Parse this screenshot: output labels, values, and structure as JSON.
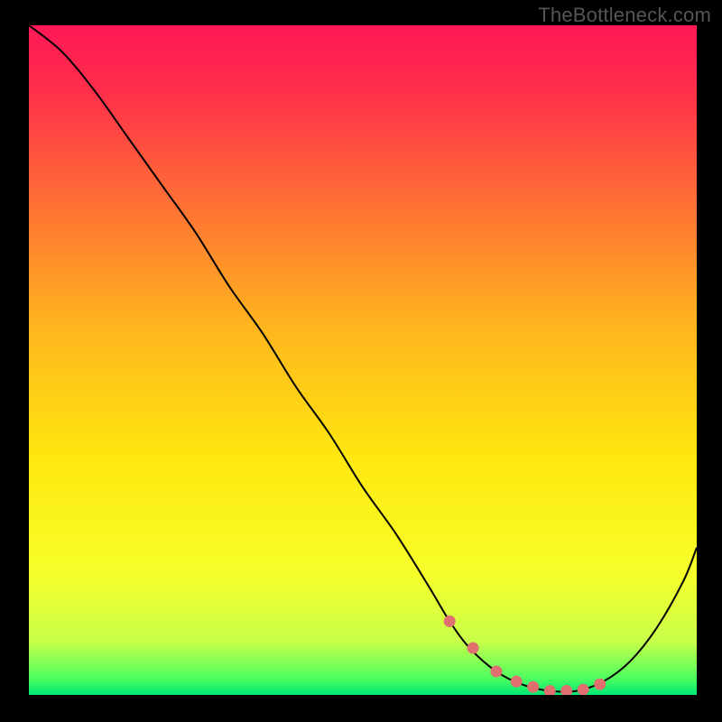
{
  "watermark": "TheBottleneck.com",
  "chart_data": {
    "type": "line",
    "title": "",
    "xlabel": "",
    "ylabel": "",
    "xlim": [
      0,
      100
    ],
    "ylim": [
      0,
      100
    ],
    "series": [
      {
        "name": "curve",
        "x": [
          0,
          5,
          10,
          15,
          20,
          25,
          30,
          35,
          40,
          45,
          50,
          55,
          60,
          63,
          66,
          70,
          74,
          78,
          82,
          86,
          90,
          94,
          98,
          100
        ],
        "y": [
          100,
          96,
          90,
          83,
          76,
          69,
          61,
          54,
          46,
          39,
          31,
          24,
          16,
          11,
          7,
          3.5,
          1.5,
          0.6,
          0.6,
          2,
          5,
          10,
          17,
          22
        ]
      }
    ],
    "markers": {
      "name": "dots",
      "x": [
        63,
        66.5,
        70,
        73,
        75.5,
        78,
        80.5,
        83,
        85.5
      ],
      "y": [
        11,
        7,
        3.5,
        2,
        1.2,
        0.6,
        0.6,
        0.8,
        1.6
      ]
    },
    "gradient_stops": [
      {
        "offset": 0.0,
        "color": "#ff1857"
      },
      {
        "offset": 0.1,
        "color": "#ff2f4a"
      },
      {
        "offset": 0.25,
        "color": "#ff6a37"
      },
      {
        "offset": 0.45,
        "color": "#ffb51e"
      },
      {
        "offset": 0.65,
        "color": "#ffe80f"
      },
      {
        "offset": 0.82,
        "color": "#f6ff2a"
      },
      {
        "offset": 0.92,
        "color": "#c8ff4a"
      },
      {
        "offset": 0.975,
        "color": "#4eff5f"
      },
      {
        "offset": 1.0,
        "color": "#00e874"
      }
    ],
    "marker_color": "#e07070",
    "curve_color": "#000000"
  }
}
